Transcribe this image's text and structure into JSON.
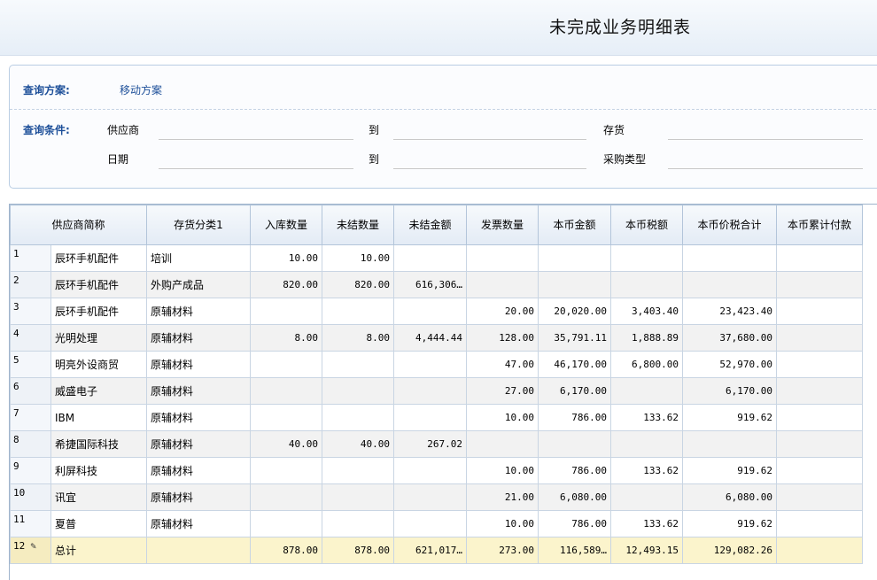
{
  "title": "未完成业务明细表",
  "query": {
    "scheme_label": "查询方案:",
    "scheme_value": "移动方案",
    "condition_label": "查询条件:",
    "fields": {
      "supplier": "供应商",
      "supplier_to": "到",
      "inventory": "存货",
      "date": "日期",
      "date_to": "到",
      "purchase_type": "采购类型"
    }
  },
  "table": {
    "headers": [
      "供应商简称",
      "存货分类1",
      "入库数量",
      "未结数量",
      "未结金额",
      "发票数量",
      "本币金额",
      "本币税额",
      "本币价税合计",
      "本币累计付款"
    ],
    "rows": [
      [
        "1",
        "辰环手机配件",
        "培训",
        "10.00",
        "10.00",
        "",
        "",
        "",
        "",
        "",
        ""
      ],
      [
        "2",
        "辰环手机配件",
        "外购产成品",
        "820.00",
        "820.00",
        "616,306…",
        "",
        "",
        "",
        "",
        ""
      ],
      [
        "3",
        "辰环手机配件",
        "原辅材料",
        "",
        "",
        "",
        "20.00",
        "20,020.00",
        "3,403.40",
        "23,423.40",
        ""
      ],
      [
        "4",
        "光明处理",
        "原辅材料",
        "8.00",
        "8.00",
        "4,444.44",
        "128.00",
        "35,791.11",
        "1,888.89",
        "37,680.00",
        ""
      ],
      [
        "5",
        "明亮外设商贸",
        "原辅材料",
        "",
        "",
        "",
        "47.00",
        "46,170.00",
        "6,800.00",
        "52,970.00",
        ""
      ],
      [
        "6",
        "威盛电子",
        "原辅材料",
        "",
        "",
        "",
        "27.00",
        "6,170.00",
        "",
        "6,170.00",
        ""
      ],
      [
        "7",
        "IBM",
        "原辅材料",
        "",
        "",
        "",
        "10.00",
        "786.00",
        "133.62",
        "919.62",
        ""
      ],
      [
        "8",
        "希捷国际科技",
        "原辅材料",
        "40.00",
        "40.00",
        "267.02",
        "",
        "",
        "",
        "",
        ""
      ],
      [
        "9",
        "利屏科技",
        "原辅材料",
        "",
        "",
        "",
        "10.00",
        "786.00",
        "133.62",
        "919.62",
        ""
      ],
      [
        "10",
        "讯宜",
        "原辅材料",
        "",
        "",
        "",
        "21.00",
        "6,080.00",
        "",
        "6,080.00",
        ""
      ],
      [
        "11",
        "夏普",
        "原辅材料",
        "",
        "",
        "",
        "10.00",
        "786.00",
        "133.62",
        "919.62",
        ""
      ]
    ],
    "total_row": [
      "12",
      "总计",
      "",
      "878.00",
      "878.00",
      "621,017…",
      "273.00",
      "116,589…",
      "12,493.15",
      "129,082.26",
      ""
    ]
  }
}
